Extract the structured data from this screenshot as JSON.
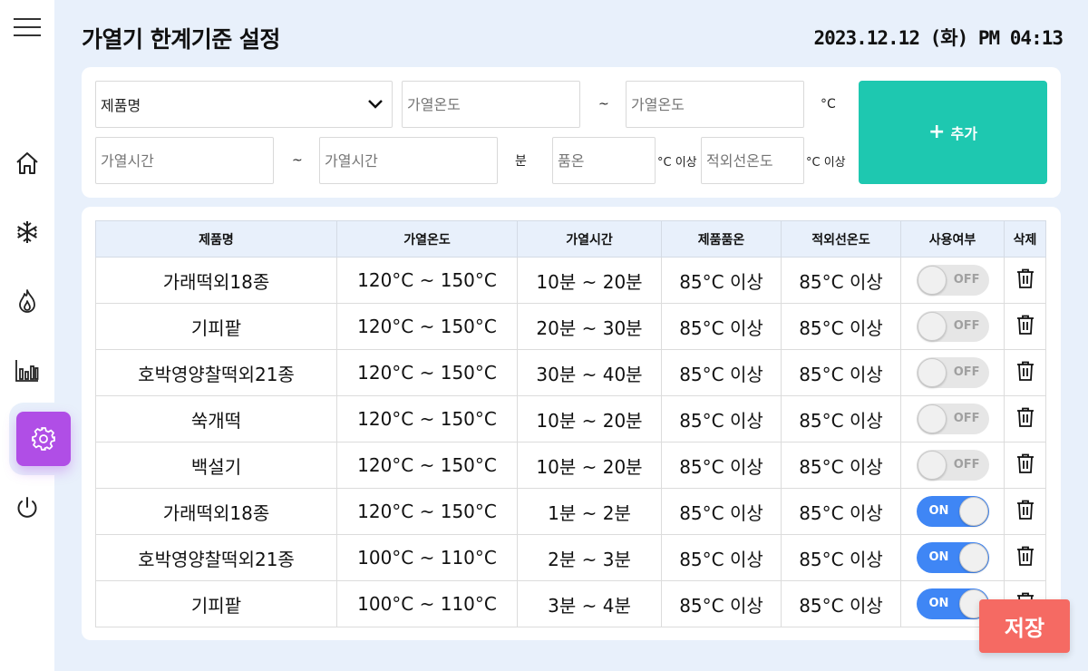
{
  "header": {
    "title": "가열기 한계기준 설정",
    "datetime": "2023.12.12 (화) PM 04:13"
  },
  "sidebar": {
    "menu_icon": "hamburger-icon",
    "items": [
      {
        "icon": "home-icon"
      },
      {
        "icon": "snowflake-icon"
      },
      {
        "icon": "flame-icon"
      },
      {
        "icon": "bar-chart-icon"
      },
      {
        "icon": "gear-icon",
        "active": true
      },
      {
        "icon": "power-icon"
      }
    ],
    "active_color": "#b04ee6"
  },
  "form": {
    "product_select": "제품명",
    "heat_temp_min_placeholder": "가열온도",
    "heat_temp_max_placeholder": "가열온도",
    "tilde": "~",
    "temp_unit": "°C",
    "heat_time_min_placeholder": "가열시간",
    "heat_time_max_placeholder": "가열시간",
    "time_unit": "분",
    "product_temp_placeholder": "품온",
    "product_temp_unit": "°C 이상",
    "ir_temp_placeholder": "적외선온도",
    "ir_temp_unit": "°C 이상",
    "add_button": "추가",
    "add_color": "#1ec8b0"
  },
  "table": {
    "headers": [
      "제품명",
      "가열온도",
      "가열시간",
      "제품품온",
      "적외선온도",
      "사용여부",
      "삭제"
    ],
    "rows": [
      {
        "name": "가래떡외18종",
        "heat_temp": "120°C ~ 150°C",
        "heat_time": "10분 ~ 20분",
        "product_temp": "85°C 이상",
        "ir_temp": "85°C 이상",
        "use": "OFF"
      },
      {
        "name": "기피팥",
        "heat_temp": "120°C ~ 150°C",
        "heat_time": "20분 ~ 30분",
        "product_temp": "85°C 이상",
        "ir_temp": "85°C 이상",
        "use": "OFF"
      },
      {
        "name": "호박영양찰떡외21종",
        "heat_temp": "120°C ~ 150°C",
        "heat_time": "30분 ~ 40분",
        "product_temp": "85°C 이상",
        "ir_temp": "85°C 이상",
        "use": "OFF"
      },
      {
        "name": "쑥개떡",
        "heat_temp": "120°C ~ 150°C",
        "heat_time": "10분 ~ 20분",
        "product_temp": "85°C 이상",
        "ir_temp": "85°C 이상",
        "use": "OFF"
      },
      {
        "name": "백설기",
        "heat_temp": "120°C ~ 150°C",
        "heat_time": "10분 ~ 20분",
        "product_temp": "85°C 이상",
        "ir_temp": "85°C 이상",
        "use": "OFF"
      },
      {
        "name": "가래떡외18종",
        "heat_temp": "120°C ~ 150°C",
        "heat_time": "1분 ~ 2분",
        "product_temp": "85°C 이상",
        "ir_temp": "85°C 이상",
        "use": "ON"
      },
      {
        "name": "호박영양찰떡외21종",
        "heat_temp": "100°C ~ 110°C",
        "heat_time": "2분 ~ 3분",
        "product_temp": "85°C 이상",
        "ir_temp": "85°C 이상",
        "use": "ON"
      },
      {
        "name": "기피팥",
        "heat_temp": "100°C ~ 110°C",
        "heat_time": "3분 ~ 4분",
        "product_temp": "85°C 이상",
        "ir_temp": "85°C 이상",
        "use": "ON"
      }
    ],
    "toggle_on_color": "#3f86f5",
    "header_bg": "#e8f0fb"
  },
  "save_button": {
    "label": "저장",
    "color": "#f56a63"
  }
}
